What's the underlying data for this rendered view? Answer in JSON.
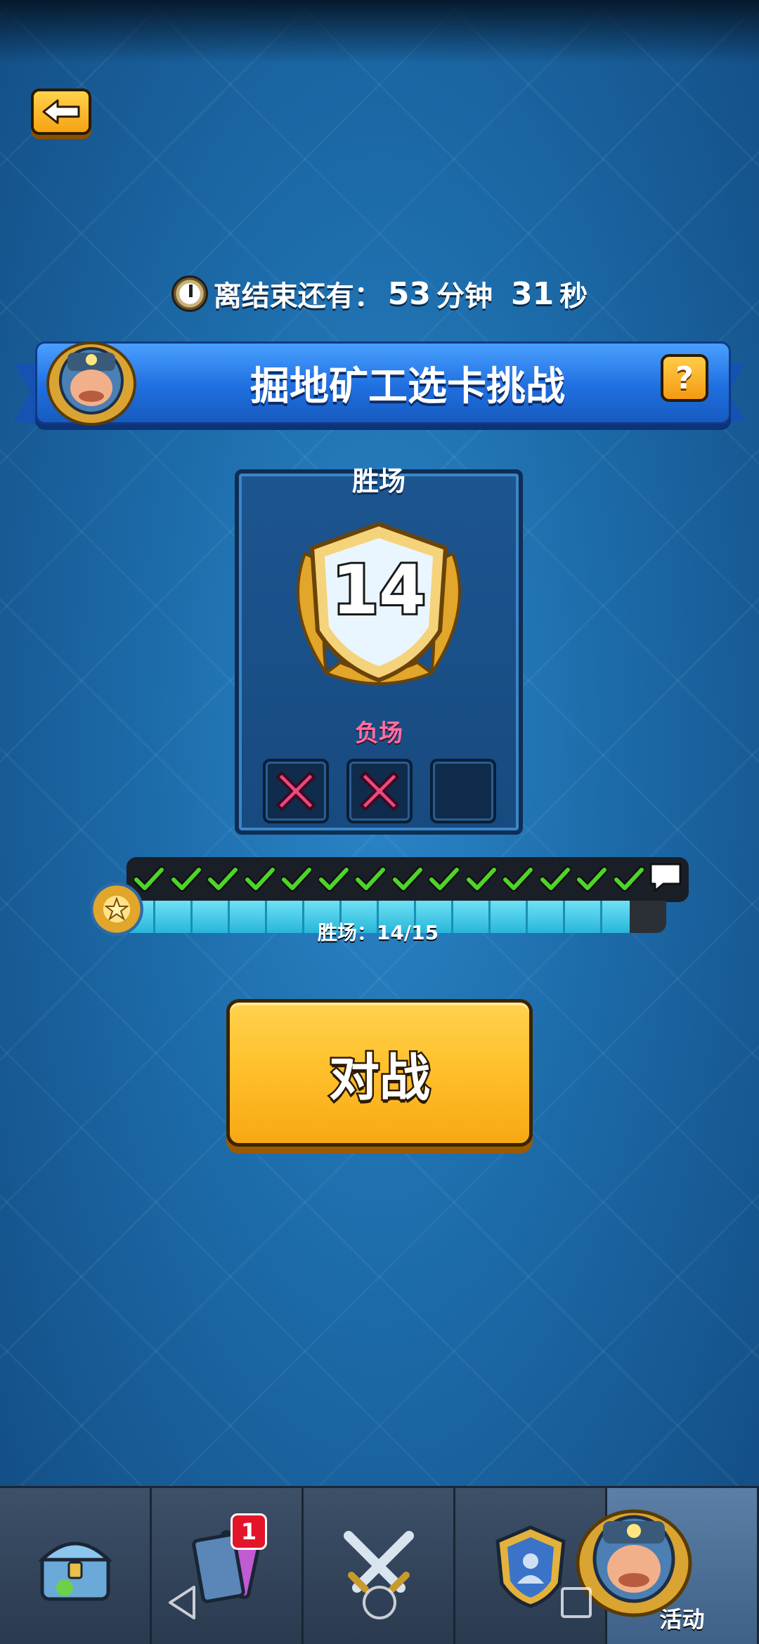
{
  "header": {
    "back_icon": "arrow-left-icon"
  },
  "timer": {
    "prefix": "离结束还有：",
    "minutes": "53",
    "minutes_unit": "分钟",
    "seconds": "31",
    "seconds_unit": "秒"
  },
  "banner": {
    "title": "掘地矿工选卡挑战",
    "help_label": "?"
  },
  "panel": {
    "wins_label": "胜场",
    "wins": "14",
    "losses_label": "负场",
    "losses": 2,
    "max_losses": 3
  },
  "progress": {
    "checks": 14,
    "total": 15,
    "text": "胜场：14/15",
    "fraction": 0.9333
  },
  "battle_button": {
    "label": "对战"
  },
  "bottom_nav": {
    "items": [
      {
        "icon": "chest-icon"
      },
      {
        "icon": "cards-icon",
        "badge": "1"
      },
      {
        "icon": "crossed-swords-icon"
      },
      {
        "icon": "clan-icon"
      },
      {
        "icon": "miner-icon",
        "label": "活动"
      }
    ]
  },
  "colors": {
    "accent_gold": "#f7a814",
    "banner_blue": "#1f6fe0",
    "check_green": "#4ed42a",
    "loss_pink": "#ff6fa0"
  }
}
